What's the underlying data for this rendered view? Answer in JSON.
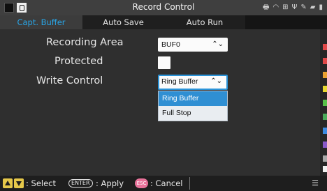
{
  "window": {
    "title": "Record Control",
    "status_icons": [
      "printer-icon",
      "wifi-icon",
      "network-icon",
      "usb-icon",
      "tool-icon",
      "sd-card-icon",
      "battery-icon"
    ]
  },
  "tabs": [
    {
      "label": "Capt. Buffer",
      "active": true
    },
    {
      "label": "Auto Save",
      "active": false
    },
    {
      "label": "Auto Run",
      "active": false
    }
  ],
  "fields": {
    "recording_area": {
      "label": "Recording Area",
      "value": "BUF0"
    },
    "protected": {
      "label": "Protected",
      "checked": false
    },
    "write_control": {
      "label": "Write Control",
      "value": "Ring Buffer"
    }
  },
  "dropdown": {
    "options": [
      "Ring Buffer",
      "Full Stop"
    ],
    "selected": "Ring Buffer"
  },
  "footer": {
    "select_text": ": Select",
    "enter_key": "ENTER",
    "apply_text": ": Apply",
    "esc_key": "ESC",
    "cancel_text": ": Cancel"
  },
  "colors": {
    "accent": "#29a5e6",
    "channel_strip": [
      "#e04848",
      "#e04848",
      "#e8a030",
      "#e8d830",
      "#58c048",
      "#48a858",
      "#3c8ae0",
      "#8a58c8",
      "#a8a8a8",
      "#f0f0f0"
    ]
  }
}
